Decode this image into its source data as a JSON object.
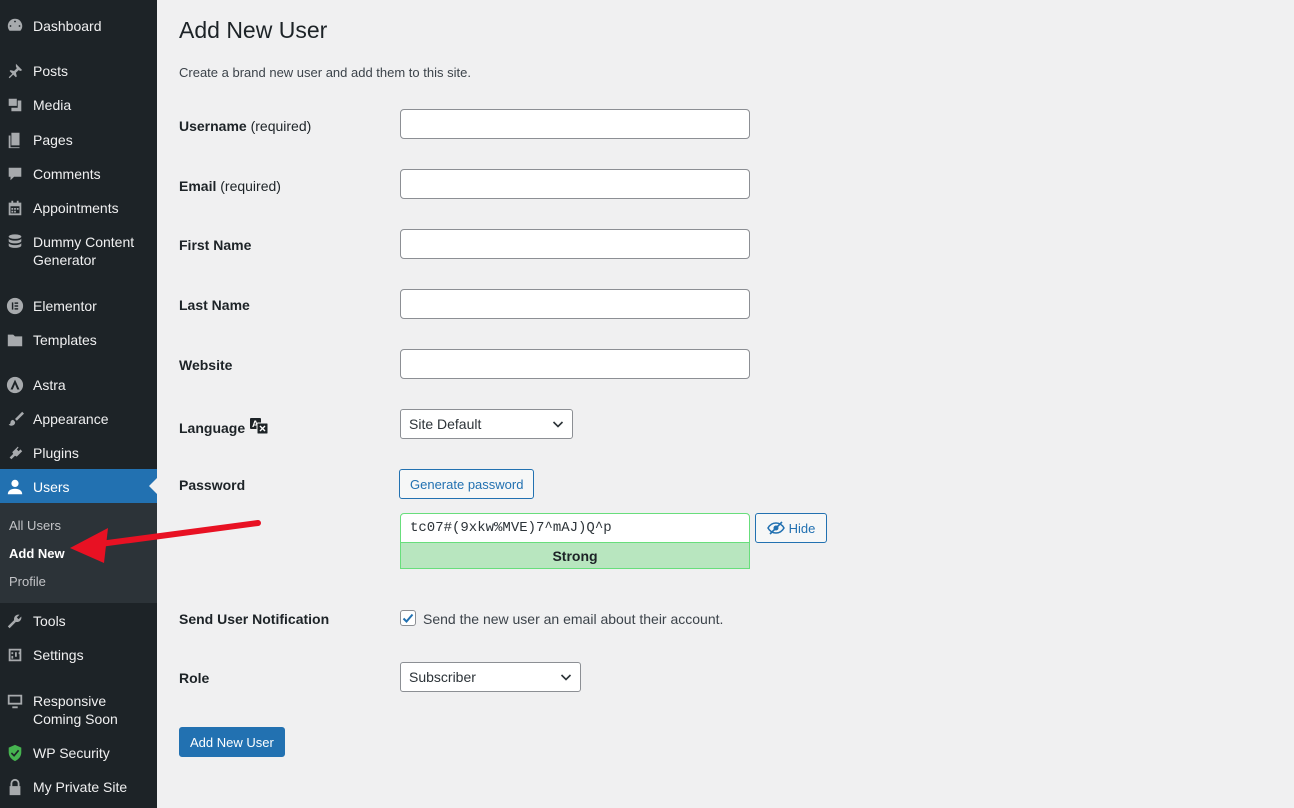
{
  "sidebar": {
    "items": [
      {
        "label": "Dashboard",
        "icon": "dashboard-icon"
      },
      {
        "label": "Posts",
        "icon": "pushpin-icon"
      },
      {
        "label": "Media",
        "icon": "media-icon"
      },
      {
        "label": "Pages",
        "icon": "pages-icon"
      },
      {
        "label": "Comments",
        "icon": "comment-icon"
      },
      {
        "label": "Appointments",
        "icon": "calendar-icon"
      },
      {
        "label": "Dummy Content Generator",
        "icon": "database-icon"
      },
      {
        "label": "Elementor",
        "icon": "elementor-icon"
      },
      {
        "label": "Templates",
        "icon": "folder-icon"
      },
      {
        "label": "Astra",
        "icon": "astra-icon"
      },
      {
        "label": "Appearance",
        "icon": "brush-icon"
      },
      {
        "label": "Plugins",
        "icon": "plugin-icon"
      },
      {
        "label": "Users",
        "icon": "user-icon"
      },
      {
        "label": "Tools",
        "icon": "wrench-icon"
      },
      {
        "label": "Settings",
        "icon": "sliders-icon"
      },
      {
        "label": "Responsive Coming Soon",
        "icon": "monitor-icon"
      },
      {
        "label": "WP Security",
        "icon": "shield-icon"
      },
      {
        "label": "My Private Site",
        "icon": "lock-icon"
      }
    ],
    "submenu": [
      "All Users",
      "Add New",
      "Profile"
    ]
  },
  "page": {
    "title": "Add New User",
    "description": "Create a brand new user and add them to this site."
  },
  "form": {
    "username_label": "Username",
    "email_label": "Email",
    "required_text": "(required)",
    "first_name_label": "First Name",
    "last_name_label": "Last Name",
    "website_label": "Website",
    "language_label": "Language",
    "language_value": "Site Default",
    "password_label": "Password",
    "generate_password_label": "Generate password",
    "password_value": "tc07#(9xkw%MVE)7^mAJ)Q^p",
    "password_strength": "Strong",
    "hide_label": "Hide",
    "notification_label": "Send User Notification",
    "notification_text": "Send the new user an email about their account.",
    "notification_checked": true,
    "role_label": "Role",
    "role_value": "Subscriber",
    "submit_label": "Add New User"
  },
  "colors": {
    "sidebar_bg": "#1d2327",
    "accent": "#2271b1",
    "strength_bg": "#b8e6bf",
    "annotation": "#e81123"
  }
}
